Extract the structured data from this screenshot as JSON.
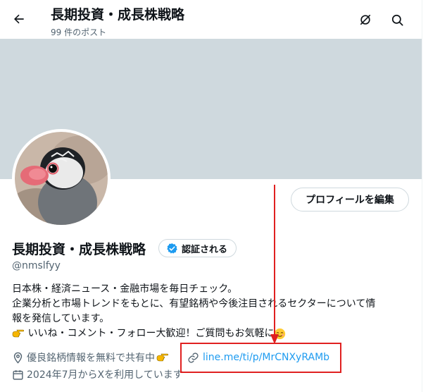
{
  "header": {
    "title": "長期投資・成長株戦略",
    "post_count": "99 件のポスト"
  },
  "profile": {
    "name": "長期投資・成長株戦略",
    "verified_label": "認証される",
    "handle": "@nmslfyy",
    "edit_button": "プロフィールを編集"
  },
  "bio": {
    "line1": "日本株・経済ニュース・金融市場を毎日チェック。",
    "line2": "企業分析と市場トレンドをもとに、有望銘柄や今後注目されるセクターについて情",
    "line3": "報を発信しています。",
    "line4": "いいね・コメント・フォロー大歓迎！ご質問もお気軽に"
  },
  "meta": {
    "location": "優良銘柄情報を無料で共有中",
    "link": "line.me/ti/p/MrCNXyRAMb",
    "joined": "2024年7月からXを利用しています"
  },
  "colors": {
    "banner": "#cfd9de",
    "link": "#1d9bf0",
    "verified": "#1d9bf0",
    "annotation": "#e02020"
  },
  "icons": [
    "back-arrow-icon",
    "grok-icon",
    "search-icon",
    "verified-badge-icon",
    "location-icon",
    "link-icon",
    "calendar-icon",
    "pointing-hand-icon",
    "smile-emoji-icon"
  ]
}
